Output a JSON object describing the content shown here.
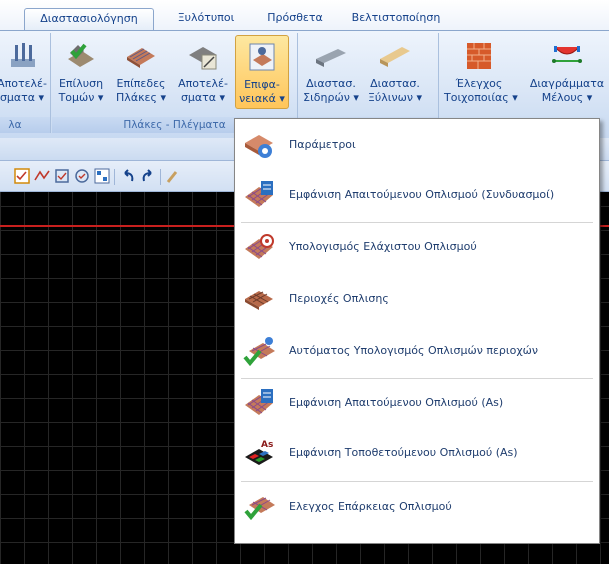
{
  "tabs": [
    "Διαστασιολόγηση",
    "Ξυλότυποι",
    "Πρόσθετα",
    "Βελτιστοποίηση"
  ],
  "ribbon": {
    "buttons": [
      {
        "line1": "Αποτελέ-",
        "line2": "σματα ▾"
      },
      {
        "line1": "Επίλυση",
        "line2": "Τομών ▾"
      },
      {
        "line1": "Επίπεδες",
        "line2": "Πλάκες ▾"
      },
      {
        "line1": "Αποτελέ-",
        "line2": "σματα ▾"
      },
      {
        "line1": "Επιφα-",
        "line2": "νειακά ▾"
      },
      {
        "line1": "Διαστασ.",
        "line2": "Σιδηρών ▾"
      },
      {
        "line1": "Διαστασ.",
        "line2": "Ξύλινων ▾"
      },
      {
        "line1": "Έλεγχος",
        "line2": "Τοιχοποιίας ▾"
      },
      {
        "line1": "Διαγράμματα",
        "line2": "Μέλους ▾"
      }
    ],
    "groups": [
      "λα",
      "Πλάκες - Πλέγματα"
    ]
  },
  "menu": {
    "items": [
      {
        "label": "Παράμετροι",
        "icon": "parameters-icon"
      },
      {
        "label": "Εμφάνιση Απαιτούμενου Οπλισμού (Συνδυασμοί)",
        "icon": "required-reinforcement-combos-icon"
      },
      {
        "label": "Υπολογισμός Ελάχιστου Οπλισμού",
        "icon": "min-reinforcement-icon"
      },
      {
        "label": "Περιοχές Οπλισης",
        "icon": "reinforcement-areas-icon"
      },
      {
        "label": "Αυτόματος Υπολογισμός Οπλισμών περιοχών",
        "icon": "auto-calc-icon"
      },
      {
        "label": "Εμφάνιση Απαιτούμενου Οπλισμού (As)",
        "icon": "required-as-icon"
      },
      {
        "label": "Εμφάνιση Τοποθετούμενου Οπλισμού (As)",
        "icon": "placed-as-icon"
      },
      {
        "label": "Ελεγχος Επάρκειας Οπλισμού",
        "icon": "adequacy-check-icon"
      }
    ]
  },
  "colors": {
    "accent": "#15428b",
    "canvas": "#000000",
    "redline": "#c8201e",
    "pressed": "#ffc55a"
  }
}
